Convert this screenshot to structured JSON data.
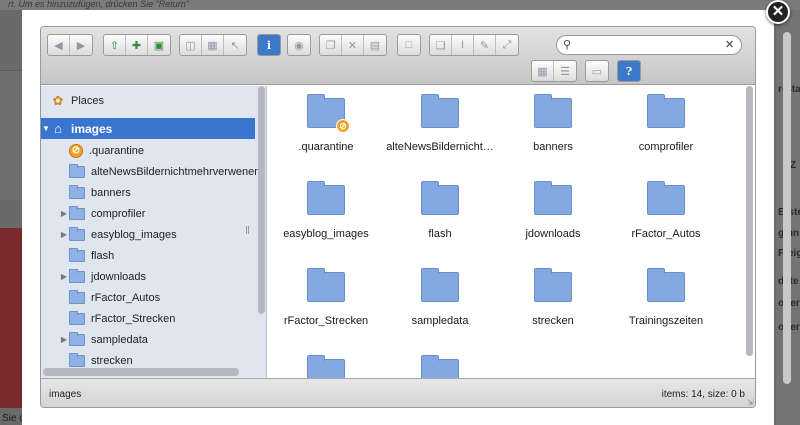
{
  "background": {
    "top_line": "rt. Um es hinzuzufügen, drücken Sie \"Return\"",
    "bottom_left_text": "Sie d",
    "right_labels": [
      "r-Sta",
      "Z",
      "Erste",
      "ginn",
      "Freig",
      "date",
      "oner",
      "oner"
    ]
  },
  "toolbar": {
    "search": {
      "placeholder": "",
      "value": ""
    },
    "nav_icons": [
      "back-icon",
      "forward-icon"
    ],
    "file_icons": [
      "upload-icon",
      "new-file-icon",
      "save-icon"
    ],
    "edit_icons": [
      "open-icon",
      "disk-icon",
      "select-icon"
    ],
    "info_icon": "info-icon",
    "view_icon": "preview-icon",
    "clipboard_icons": [
      "copy-icon",
      "cut-icon",
      "paste-icon"
    ],
    "archive_icons": [
      "archive-icon"
    ],
    "misc_icons": [
      "duplicate-icon",
      "rename-icon",
      "edit-icon",
      "resize-icon"
    ],
    "view_mode_icons": [
      "icon-view-icon",
      "list-view-icon"
    ],
    "window_icon": "window-icon",
    "help_icon": "help-icon"
  },
  "sidebar": {
    "places_label": "Places",
    "root": {
      "label": "images",
      "selected": true
    },
    "items": [
      {
        "label": ".quarantine",
        "expandable": false,
        "special": true
      },
      {
        "label": "alteNewsBildernichtmehrverwenen",
        "expandable": false
      },
      {
        "label": "banners",
        "expandable": false
      },
      {
        "label": "comprofiler",
        "expandable": true
      },
      {
        "label": "easyblog_images",
        "expandable": true
      },
      {
        "label": "flash",
        "expandable": false
      },
      {
        "label": "jdownloads",
        "expandable": true
      },
      {
        "label": "rFactor_Autos",
        "expandable": false
      },
      {
        "label": "rFactor_Strecken",
        "expandable": false
      },
      {
        "label": "sampledata",
        "expandable": true
      },
      {
        "label": "strecken",
        "expandable": false
      }
    ]
  },
  "files": [
    {
      "name": ".quarantine",
      "badge": true
    },
    {
      "name": "alteNewsBildernicht…"
    },
    {
      "name": "banners"
    },
    {
      "name": "comprofiler"
    },
    {
      "name": "easyblog_images"
    },
    {
      "name": "flash"
    },
    {
      "name": "jdownloads"
    },
    {
      "name": "rFactor_Autos"
    },
    {
      "name": "rFactor_Strecken"
    },
    {
      "name": "sampledata"
    },
    {
      "name": "strecken"
    },
    {
      "name": "Trainingszeiten"
    },
    {
      "name": ""
    },
    {
      "name": ""
    }
  ],
  "status": {
    "path": "images",
    "summary": "items: 14, size: 0 b"
  },
  "colors": {
    "selection": "#3a76d0",
    "folder": "#84a8e2",
    "sidebar_bg": "#dfe6f0",
    "badge": "#f3a323"
  }
}
